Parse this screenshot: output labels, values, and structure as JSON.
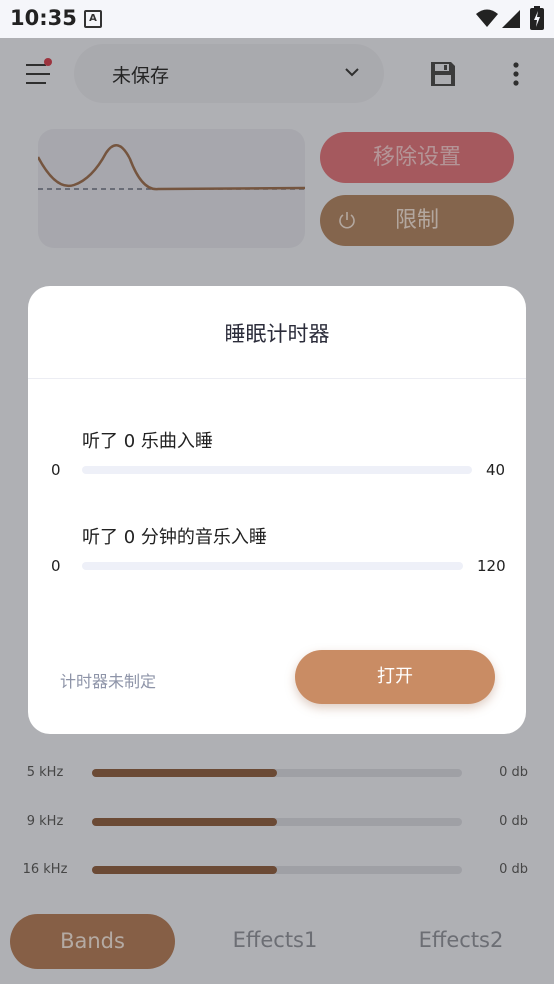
{
  "status_bar": {
    "time": "10:35",
    "notif_letter": "A"
  },
  "app_bar": {
    "preset_label": "未保存"
  },
  "actions": {
    "remove_label": "移除设置",
    "limit_label": "限制"
  },
  "bands": [
    {
      "label": "5 kHz",
      "value": "0 db",
      "fill": 0.5
    },
    {
      "label": "9 kHz",
      "value": "0 db",
      "fill": 0.5
    },
    {
      "label": "16 kHz",
      "value": "0 db",
      "fill": 0.5
    }
  ],
  "bottom_nav": {
    "tab1": "Bands",
    "tab2": "Effects1",
    "tab3": "Effects2"
  },
  "dialog": {
    "title": "睡眠计时器",
    "songs": {
      "label": "听了 0 乐曲入睡",
      "min": "0",
      "max": "40",
      "value": 0
    },
    "minutes": {
      "label": "听了 0 分钟的音乐入睡",
      "min": "0",
      "max": "120",
      "value": 0
    },
    "status": "计时器未制定",
    "open_label": "打开"
  },
  "colors": {
    "accent": "#c98c64",
    "bar_fill": "#8b5a3c",
    "remove": "#e07078"
  }
}
